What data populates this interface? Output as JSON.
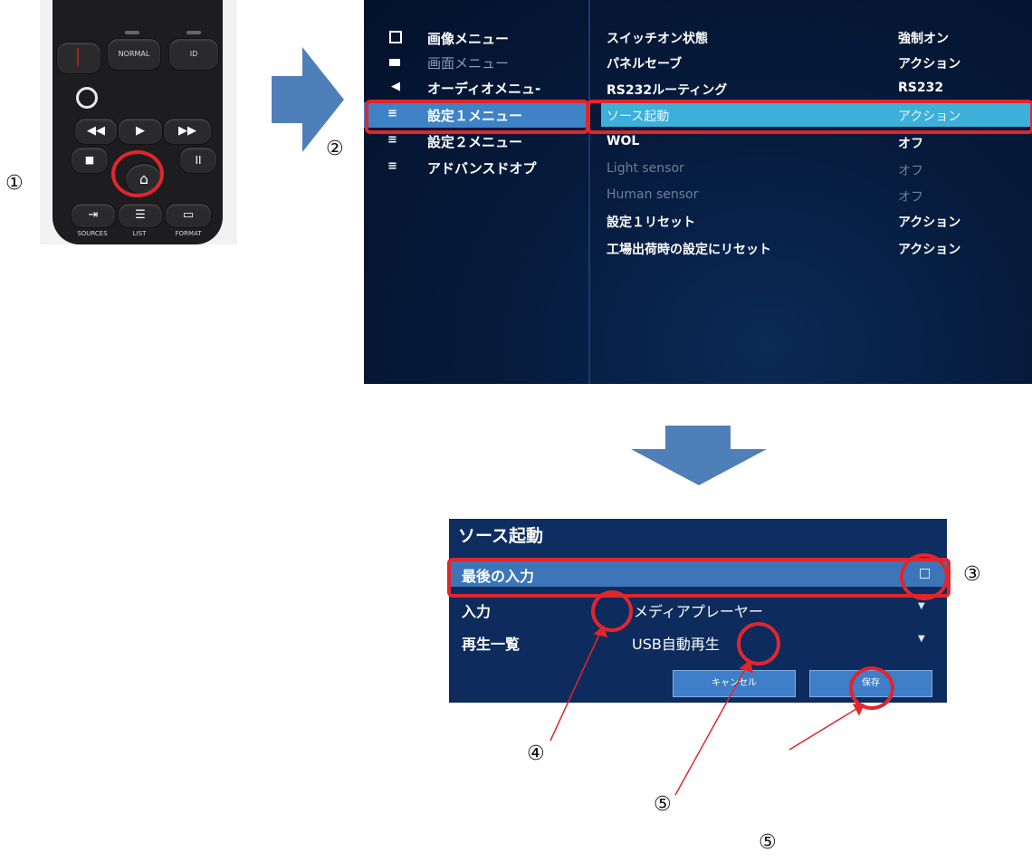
{
  "step_labels": {
    "s1": "①",
    "s2": "②",
    "s3": "③",
    "s4": "④",
    "s5a": "⑤",
    "s5b": "⑤"
  },
  "remote": {
    "buttons": {
      "normal": "NORMAL",
      "id": "ID",
      "sources": "SOURCES",
      "list": "LIST",
      "format": "FORMAT"
    }
  },
  "menu": {
    "left_items": [
      {
        "label": "画像メニュー",
        "icon": "picture-icon"
      },
      {
        "label": "画面メニュー",
        "icon": "monitor-icon"
      },
      {
        "label": "オーディオメニュ-",
        "icon": "speaker-icon"
      },
      {
        "label": "設定１メニュー",
        "icon": "settings-sliders-icon"
      },
      {
        "label": "設定２メニュー",
        "icon": "settings-sliders-icon"
      },
      {
        "label": "アドバンスドオプ",
        "icon": "settings-sliders-icon"
      }
    ],
    "right_items": [
      {
        "label": "スイッチオン状態",
        "value": "強制オン"
      },
      {
        "label": "パネルセーブ",
        "value": "アクション"
      },
      {
        "label": "RS232ルーティング",
        "value": "RS232"
      },
      {
        "label": "ソース起動",
        "value": "アクション"
      },
      {
        "label": "WOL",
        "value": "オフ"
      },
      {
        "label": "Light sensor",
        "value": "オフ"
      },
      {
        "label": "Human sensor",
        "value": "オフ"
      },
      {
        "label": "設定１リセット",
        "value": "アクション"
      },
      {
        "label": "工場出荷時の設定にリセット",
        "value": "アクション"
      }
    ]
  },
  "dialog": {
    "title": "ソース起動",
    "rows": [
      {
        "label": "最後の入力",
        "value": ""
      },
      {
        "label": "入力",
        "value": "メディアプレーヤー"
      },
      {
        "label": "再生一覧",
        "value": "USB自動再生"
      }
    ],
    "cancel_label": "キャンセル",
    "save_label": "保存"
  },
  "colors": {
    "annotation_red": "#e0262d",
    "arrow_blue": "#4f7fb9",
    "menu_highlight": "#3f83c6",
    "row_highlight": "#3cb0d9"
  }
}
